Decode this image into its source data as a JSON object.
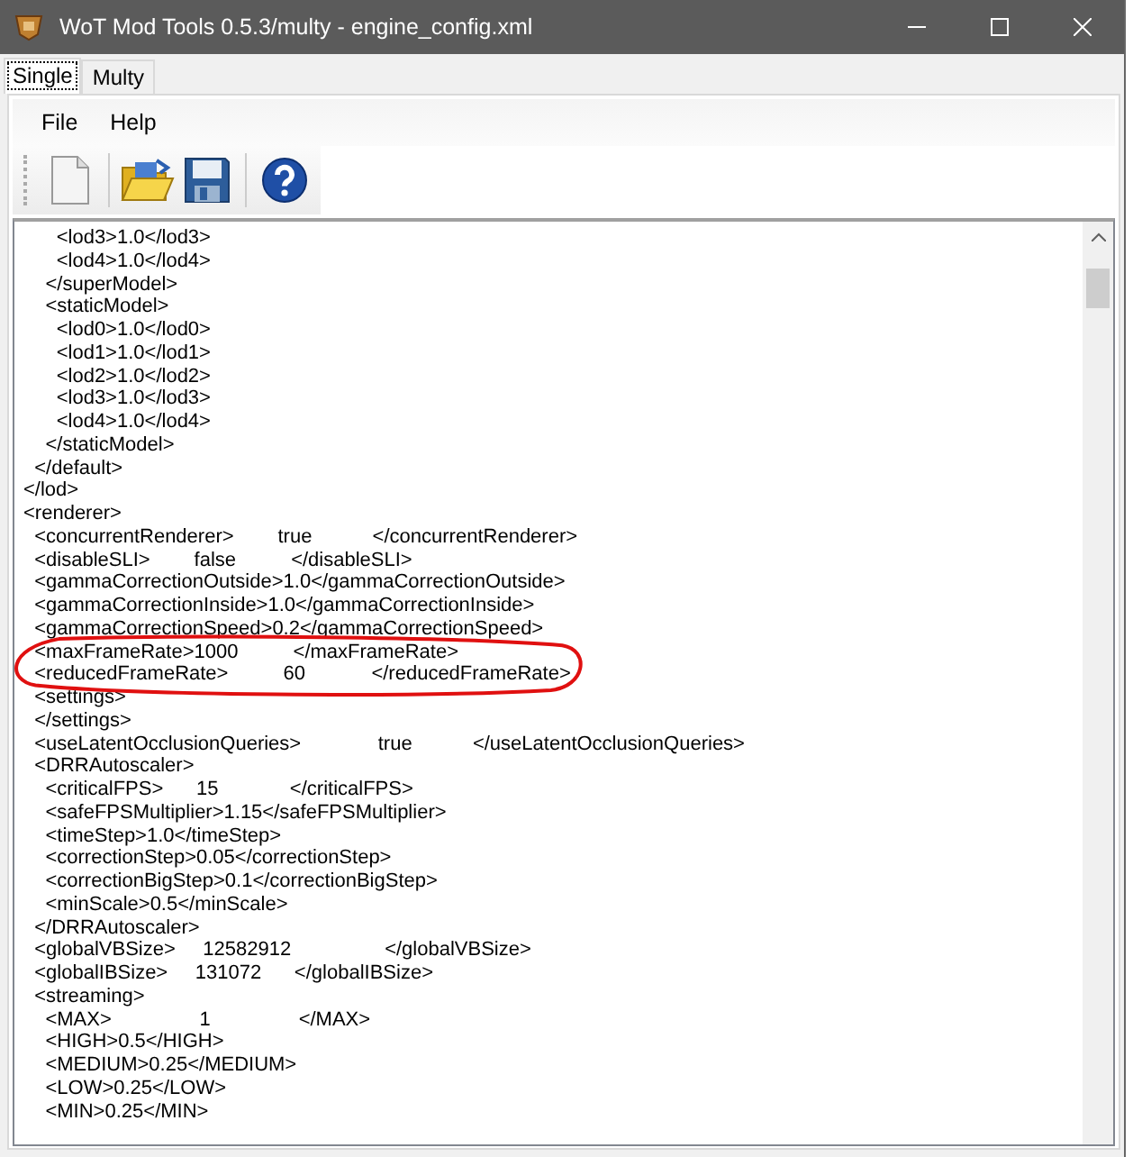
{
  "window": {
    "title": "WoT Mod Tools 0.5.3/multy - engine_config.xml"
  },
  "tabs": [
    {
      "label": "Single",
      "selected": true
    },
    {
      "label": "Multy",
      "selected": false
    }
  ],
  "menu": [
    "File",
    "Help"
  ],
  "toolbar": [
    {
      "kind": "new"
    },
    {
      "kind": "open"
    },
    {
      "kind": "save"
    },
    {
      "kind": "help"
    }
  ],
  "editor": {
    "lines": [
      {
        "text": "      <lod3>1.0</lod3>",
        "circled": false
      },
      {
        "text": "      <lod4>1.0</lod4>",
        "circled": false
      },
      {
        "text": "    </superModel>",
        "circled": false
      },
      {
        "text": "    <staticModel>",
        "circled": false
      },
      {
        "text": "      <lod0>1.0</lod0>",
        "circled": false
      },
      {
        "text": "      <lod1>1.0</lod1>",
        "circled": false
      },
      {
        "text": "      <lod2>1.0</lod2>",
        "circled": false
      },
      {
        "text": "      <lod3>1.0</lod3>",
        "circled": false
      },
      {
        "text": "      <lod4>1.0</lod4>",
        "circled": false
      },
      {
        "text": "    </staticModel>",
        "circled": false
      },
      {
        "text": "  </default>",
        "circled": false
      },
      {
        "text": "</lod>",
        "circled": false
      },
      {
        "text": "<renderer>",
        "circled": false
      },
      {
        "text": "  <concurrentRenderer>        true           </concurrentRenderer>",
        "circled": false
      },
      {
        "text": "  <disableSLI>        false          </disableSLI>",
        "circled": false
      },
      {
        "text": "  <gammaCorrectionOutside>1.0</gammaCorrectionOutside>",
        "circled": false
      },
      {
        "text": "  <gammaCorrectionInside>1.0</gammaCorrectionInside>",
        "circled": false
      },
      {
        "text": "  <gammaCorrectionSpeed>0.2</gammaCorrectionSpeed>",
        "circled": false
      },
      {
        "text": "  <maxFrameRate>1000          </maxFrameRate>",
        "circled": true
      },
      {
        "text": "  <reducedFrameRate>          60            </reducedFrameRate>",
        "circled": true
      },
      {
        "text": "  <settings>",
        "circled": false
      },
      {
        "text": "  </settings>",
        "circled": false
      },
      {
        "text": "  <useLatentOcclusionQueries>              true           </useLatentOcclusionQueries>",
        "circled": false
      },
      {
        "text": "  <DRRAutoscaler>",
        "circled": false
      },
      {
        "text": "    <criticalFPS>      15             </criticalFPS>",
        "circled": false
      },
      {
        "text": "    <safeFPSMultiplier>1.15</safeFPSMultiplier>",
        "circled": false
      },
      {
        "text": "    <timeStep>1.0</timeStep>",
        "circled": false
      },
      {
        "text": "    <correctionStep>0.05</correctionStep>",
        "circled": false
      },
      {
        "text": "    <correctionBigStep>0.1</correctionBigStep>",
        "circled": false
      },
      {
        "text": "    <minScale>0.5</minScale>",
        "circled": false
      },
      {
        "text": "  </DRRAutoscaler>",
        "circled": false
      },
      {
        "text": "  <globalVBSize>     12582912                 </globalVBSize>",
        "circled": false
      },
      {
        "text": "  <globalIBSize>     131072      </globalIBSize>",
        "circled": false
      },
      {
        "text": "  <streaming>",
        "circled": false
      },
      {
        "text": "    <MAX>                1                </MAX>",
        "circled": false
      },
      {
        "text": "    <HIGH>0.5</HIGH>",
        "circled": false
      },
      {
        "text": "    <MEDIUM>0.25</MEDIUM>",
        "circled": false
      },
      {
        "text": "    <LOW>0.25</LOW>",
        "circled": false
      },
      {
        "text": "    <MIN>0.25</MIN>",
        "circled": false
      }
    ]
  }
}
